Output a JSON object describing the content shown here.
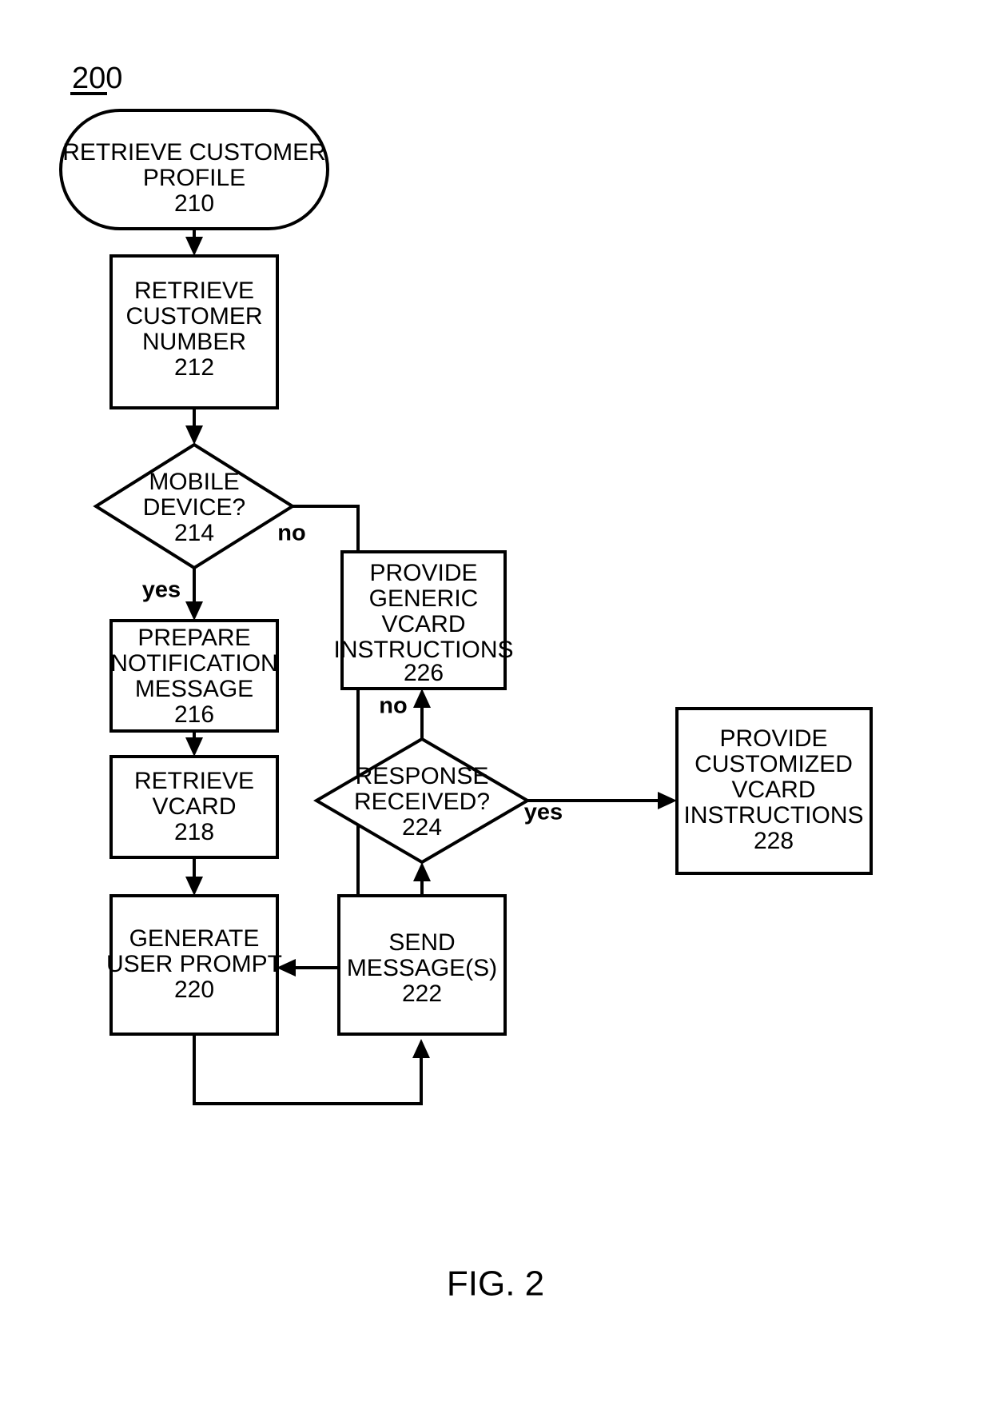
{
  "figure": {
    "reference_numeral": "200",
    "caption": "FIG. 2"
  },
  "nodes": {
    "n210": {
      "shape": "stadium",
      "line1": "RETRIEVE CUSTOMER",
      "line2": "PROFILE",
      "numeral": "210"
    },
    "n212": {
      "shape": "process",
      "line1": "RETRIEVE",
      "line2": "CUSTOMER",
      "line3": "NUMBER",
      "numeral": "212"
    },
    "n214": {
      "shape": "decision",
      "line1": "MOBILE",
      "line2": "DEVICE?",
      "numeral": "214"
    },
    "n216": {
      "shape": "process",
      "line1": "PREPARE",
      "line2": "NOTIFICATION",
      "line3": "MESSAGE",
      "numeral": "216"
    },
    "n218": {
      "shape": "process",
      "line1": "RETRIEVE",
      "line2": "VCARD",
      "numeral": "218"
    },
    "n220": {
      "shape": "process",
      "line1": "GENERATE",
      "line2": "USER PROMPT",
      "numeral": "220"
    },
    "n222": {
      "shape": "process",
      "line1": "SEND",
      "line2": "MESSAGE(S)",
      "numeral": "222"
    },
    "n224": {
      "shape": "decision",
      "line1": "RESPONSE",
      "line2": "RECEIVED?",
      "numeral": "224"
    },
    "n226": {
      "shape": "process",
      "line1": "PROVIDE",
      "line2": "GENERIC",
      "line3": "VCARD",
      "line4": "INSTRUCTIONS",
      "numeral": "226"
    },
    "n228": {
      "shape": "process",
      "line1": "PROVIDE",
      "line2": "CUSTOMIZED",
      "line3": "VCARD",
      "line4": "INSTRUCTIONS",
      "numeral": "228"
    }
  },
  "branch_labels": {
    "mobile_device_no": "no",
    "mobile_device_yes": "yes",
    "response_received_no": "no",
    "response_received_yes": "yes"
  },
  "colors": {
    "stroke": "#000000",
    "fill": "#ffffff",
    "text": "#000000"
  }
}
